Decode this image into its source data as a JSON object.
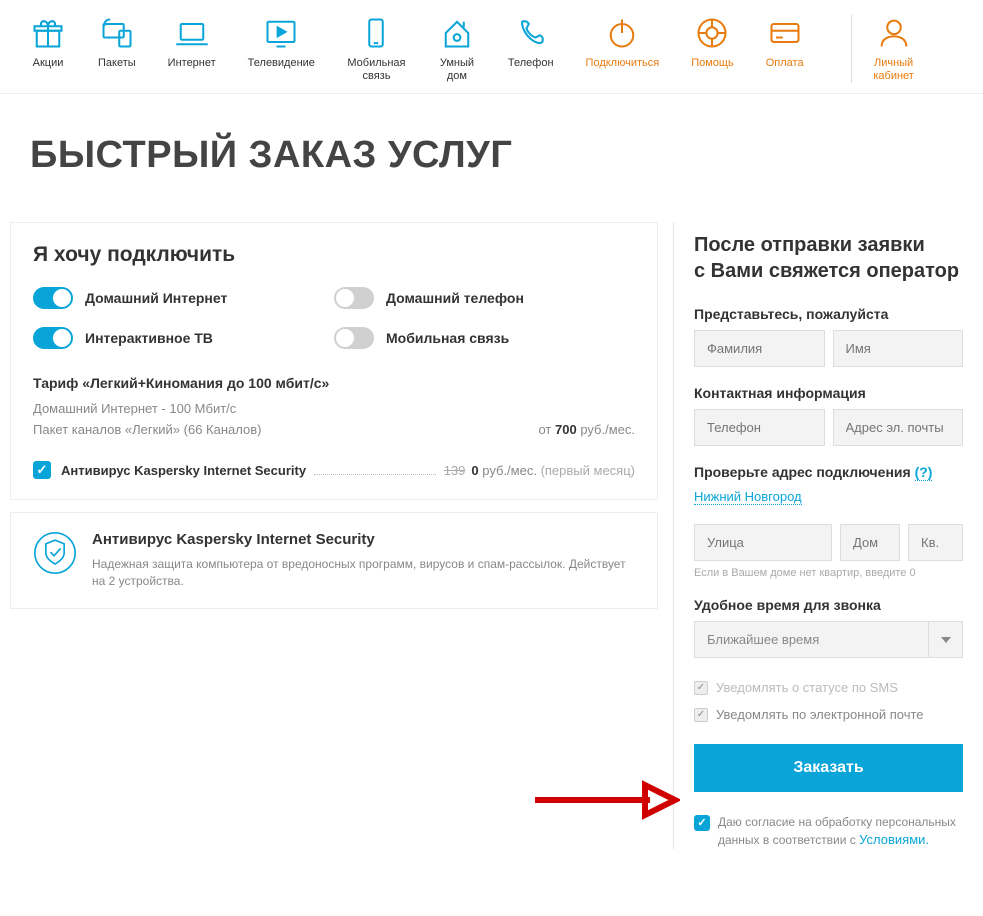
{
  "nav": [
    {
      "label": "Акции",
      "icon": "gift-icon"
    },
    {
      "label": "Пакеты",
      "icon": "devices-icon"
    },
    {
      "label": "Интернет",
      "icon": "laptop-icon"
    },
    {
      "label": "Телевидение",
      "icon": "tv-icon"
    },
    {
      "label": "Мобильная связь",
      "icon": "mobile-icon"
    },
    {
      "label": "Умный дом",
      "icon": "home-icon"
    },
    {
      "label": "Телефон",
      "icon": "phone-icon"
    },
    {
      "label": "Подключиться",
      "icon": "power-icon",
      "orange": true
    },
    {
      "label": "Помощь",
      "icon": "lifebuoy-icon",
      "orange": true
    },
    {
      "label": "Оплата",
      "icon": "card-icon",
      "orange": true
    },
    {
      "label": "Личный кабинет",
      "icon": "user-icon",
      "orange": true,
      "after_divider": true
    }
  ],
  "page_title": "БЫСТРЫЙ ЗАКАЗ УСЛУГ",
  "connect": {
    "heading": "Я хочу подключить",
    "toggles": [
      {
        "label": "Домашний Интернет",
        "on": true
      },
      {
        "label": "Домашний телефон",
        "on": false
      },
      {
        "label": "Интерактивное ТВ",
        "on": true
      },
      {
        "label": "Мобильная связь",
        "on": false
      }
    ]
  },
  "tariff": {
    "title": "Тариф «Легкий+Киномания до 100 мбит/с»",
    "line1": "Домашний Интернет - 100 Мбит/с",
    "line2": "Пакет каналов «Легкий» (66 Каналов)",
    "price_prefix": "от ",
    "price_value": "700",
    "price_suffix": " руб./мес."
  },
  "addon": {
    "name": "Антивирус Kaspersky Internet Security",
    "strike": "139",
    "zero": "0",
    "unit": " руб./мес. ",
    "note": "(первый месяц)"
  },
  "info": {
    "title": "Антивирус Kaspersky Internet Security",
    "desc": "Надежная защита компьютера от вредоносных программ, вирусов и спам-рассылок. Действует на 2 устройства."
  },
  "form": {
    "title1": "После отправки заявки",
    "title2": "с Вами свяжется оператор",
    "label_name": "Представьтесь, пожалуйста",
    "ph_lastname": "Фамилия",
    "ph_firstname": "Имя",
    "label_contact": "Контактная информация",
    "ph_phone": "Телефон",
    "ph_email": "Адрес эл. почты",
    "label_address": "Проверьте адрес подключения",
    "q": "(?)",
    "city": "Нижний Новгород",
    "ph_street": "Улица",
    "ph_house": "Дом",
    "ph_apt": "Кв.",
    "hint": "Если в Вашем доме нет квартир, введите 0",
    "label_time": "Удобное время для звонка",
    "time_value": "Ближайшее время",
    "notify_sms": "Уведомлять о статусе по SMS",
    "notify_email": "Уведомлять по электронной почте",
    "order_btn": "Заказать",
    "consent_text": "Даю согласие на обработку персональных данных в соответствии с ",
    "consent_link": "Условиями."
  }
}
